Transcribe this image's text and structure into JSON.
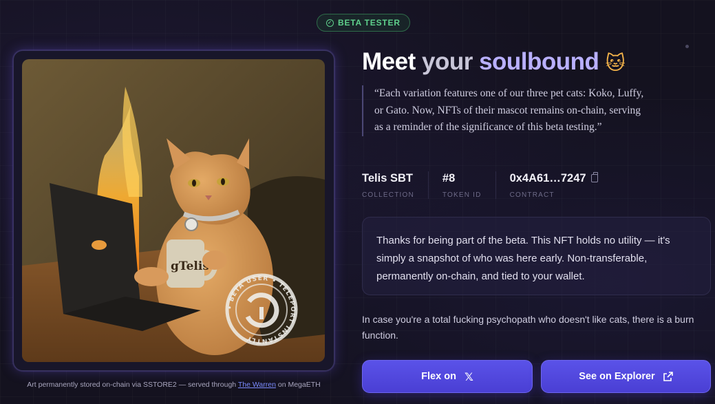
{
  "badge": {
    "label": "BETA TESTER",
    "icon": "check-circle-icon",
    "color": "#5fd08c"
  },
  "artwork": {
    "mug_text": "gTelis",
    "stamp_text": "• BETA USER • TELEPORT INSTANTLY",
    "caption_prefix": "Art permanently stored on-chain via SSTORE2 — served through ",
    "caption_link": "The Warren",
    "caption_suffix": " on MegaETH"
  },
  "headline": {
    "word1": "Meet",
    "word2": "your",
    "word3": "soulbound",
    "emoji": "🐱"
  },
  "quote": "“Each variation features one of our three pet cats: Koko, Luffy, or Gato. Now, NFTs of their mascot remains on-chain, serving as a reminder of the significance of this beta testing.”",
  "meta": {
    "collection": {
      "value": "Telis SBT",
      "label": "COLLECTION"
    },
    "token": {
      "value": "#8",
      "label": "TOKEN ID"
    },
    "contract": {
      "value": "0x4A61…7247",
      "label": "CONTRACT"
    }
  },
  "notice": "Thanks for being part of the beta. This NFT holds no utility — it's simply a snapshot of who was here early. Non-transferable, permanently on-chain, and tied to your wallet.",
  "burn_text": "In case you're a total fucking psychopath who doesn't like cats, there is a burn function.",
  "buttons": {
    "flex_label": "Flex on",
    "flex_icon": "x-logo-icon",
    "explorer_label": "See on Explorer",
    "explorer_icon": "external-link-icon"
  },
  "colors": {
    "accent": "#5a52e8",
    "headline_accent": "#b9b0ff",
    "link": "#7c8cff"
  }
}
